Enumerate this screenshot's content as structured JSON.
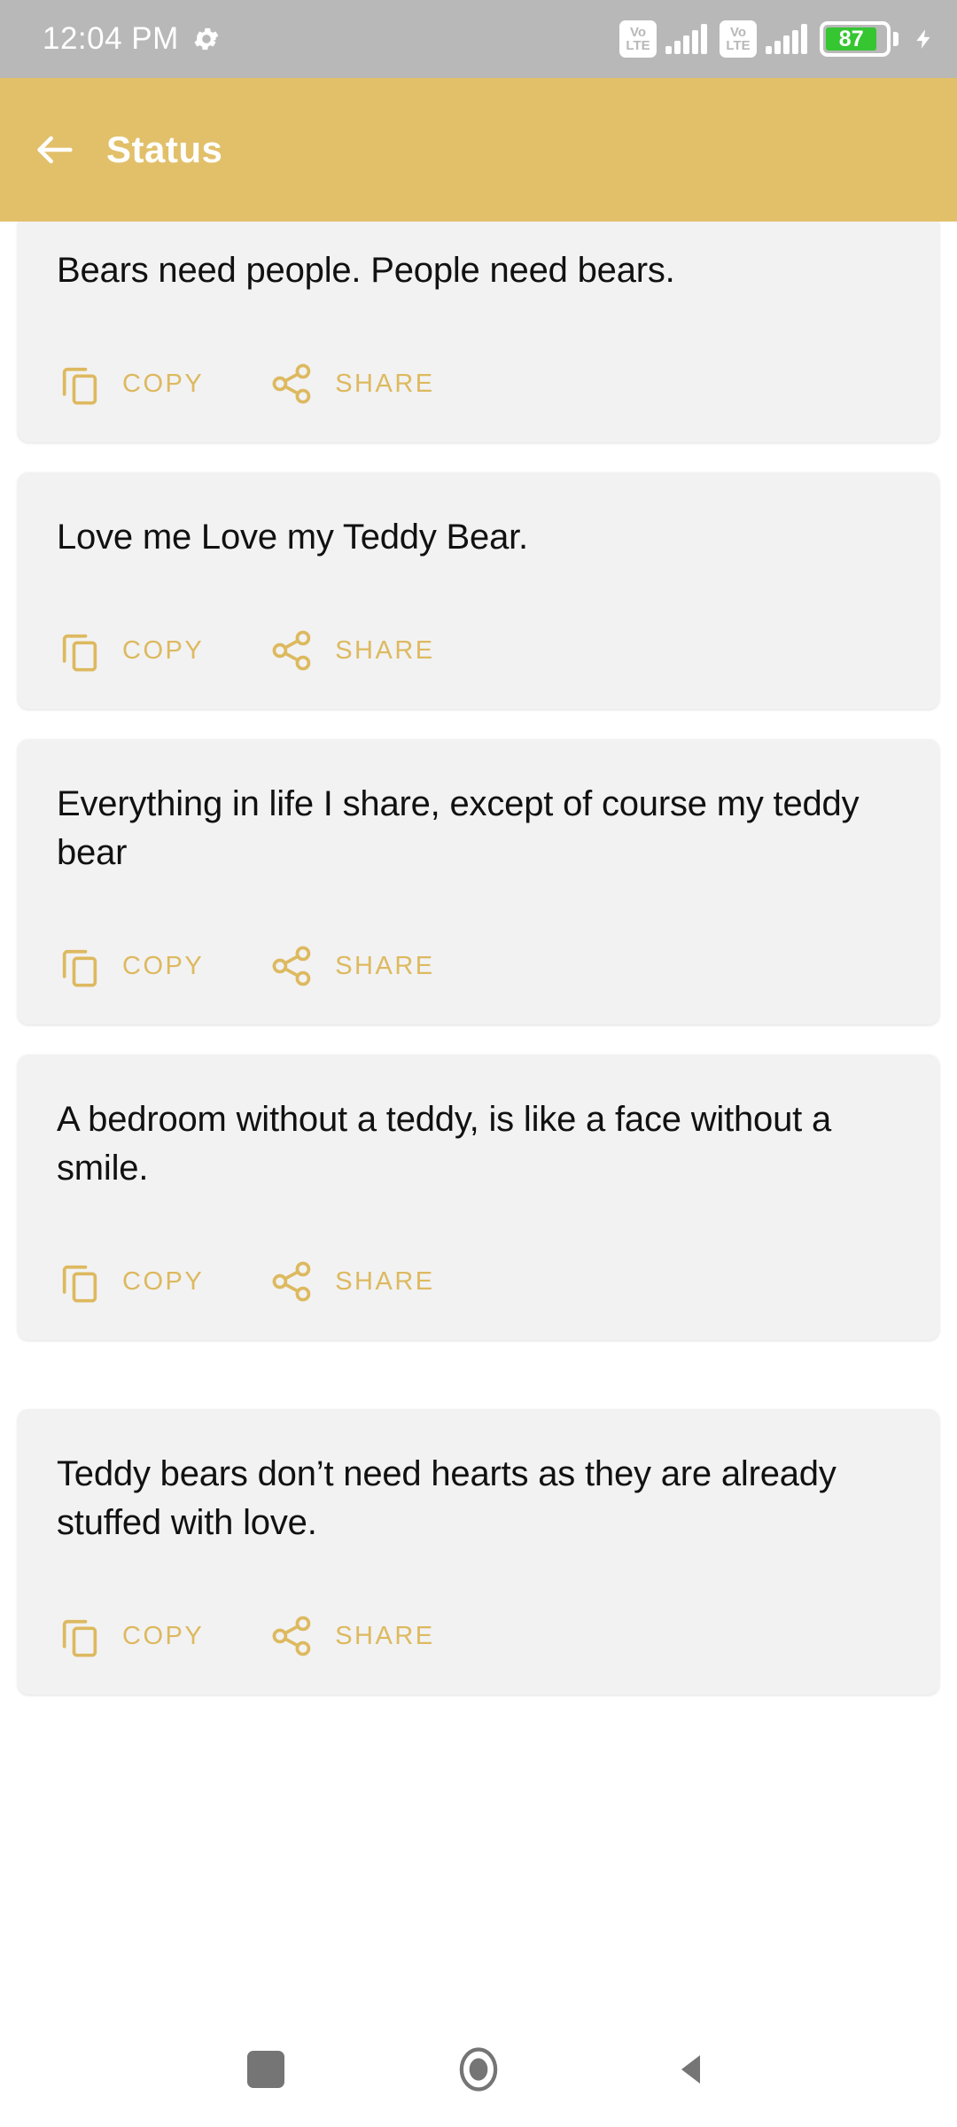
{
  "statusbar": {
    "time": "12:04 PM",
    "gear_icon": "gear-icon",
    "sim1_network": "VoLTE",
    "sim1_network_line1": "Vo",
    "sim1_network_line2": "LTE",
    "sim2_network_line1": "Vo",
    "sim2_network_line2": "LTE",
    "battery_percent": "87",
    "battery_color": "#35c632",
    "charging_icon": "charging-bolt-icon",
    "background_color": "#b8b8b8"
  },
  "appbar": {
    "back_icon": "arrow-left-icon",
    "title": "Status",
    "background_color": "#e2c06a",
    "text_color": "#ffffff"
  },
  "actions": {
    "copy_label": "COPY",
    "share_label": "SHARE",
    "copy_icon": "copy-icon",
    "share_icon": "share-icon",
    "accent_color": "#ddb95f"
  },
  "cards": [
    {
      "quote": "Bears need people. People need bears."
    },
    {
      "quote": "Love me Love my Teddy Bear."
    },
    {
      "quote": "Everything in life I share, except of course my teddy bear"
    },
    {
      "quote": "A bedroom without a teddy, is like a face without a smile."
    },
    {
      "quote": "Teddy bears don’t need hearts as they are already stuffed with love."
    }
  ],
  "navbar": {
    "recents_icon": "recents-square-icon",
    "home_icon": "home-circle-icon",
    "back_icon": "back-triangle-icon"
  }
}
